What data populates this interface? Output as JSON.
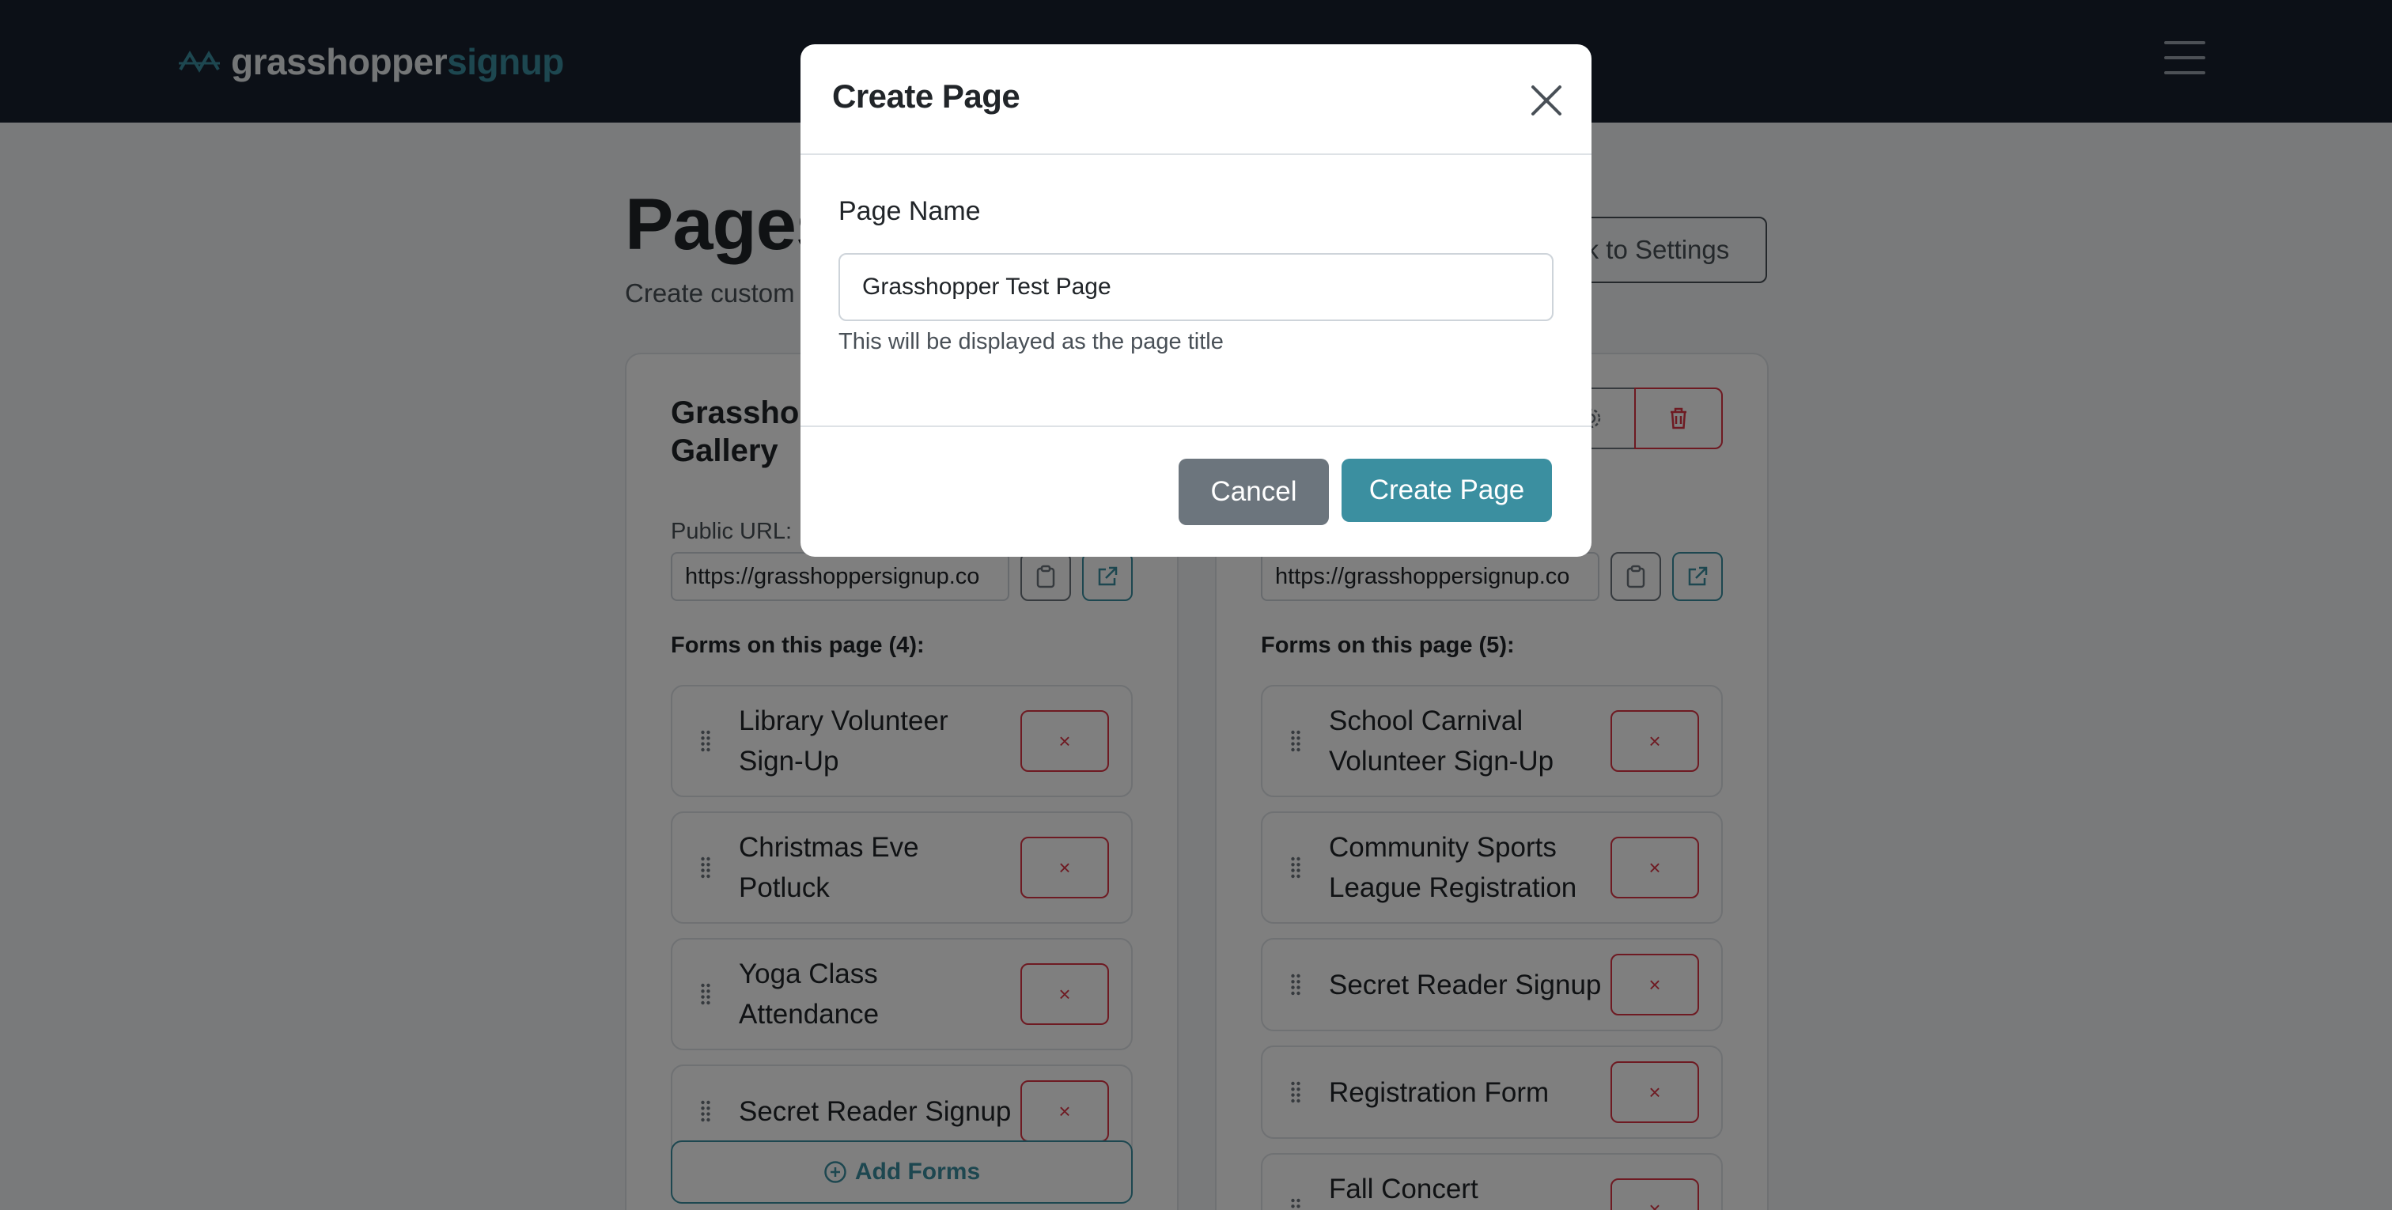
{
  "navbar": {
    "logo_part1": "grasshopper",
    "logo_part2": "signup"
  },
  "header": {
    "title": "Pages",
    "subtitle": "Create custom",
    "back_label": "Back to Settings"
  },
  "cards": [
    {
      "title_line1": "Grasshop",
      "title_line2": "Gallery",
      "url_label": "Public URL:",
      "url_value": "https://grasshoppersignup.co",
      "forms_label": "Forms on this page (4):",
      "forms": [
        {
          "name": "Library Volunteer Sign-Up"
        },
        {
          "name": "Christmas Eve Potluck"
        },
        {
          "name": "Yoga Class Attendance"
        },
        {
          "name": "Secret Reader Signup"
        }
      ],
      "add_label": "Add Forms"
    },
    {
      "url_value": "https://grasshoppersignup.co",
      "forms_label": "Forms on this page (5):",
      "forms": [
        {
          "name": "School Carnival Volunteer Sign-Up"
        },
        {
          "name": "Community Sports League Registration"
        },
        {
          "name": "Secret Reader Signup"
        },
        {
          "name": "Registration Form"
        },
        {
          "name": "Fall Concert Volunteer Signup"
        }
      ]
    }
  ],
  "remove_label": "×",
  "modal": {
    "title": "Create Page",
    "field_label": "Page Name",
    "field_value": "Grasshopper Test Page",
    "field_help": "This will be displayed as the page title",
    "cancel_label": "Cancel",
    "create_label": "Create Page"
  },
  "colors": {
    "navbar": "#19212e",
    "accent": "#3b8fa0",
    "danger": "#dc3545",
    "secondary": "#6c757d"
  },
  "icons": [
    "logo-icon",
    "hamburger-icon",
    "settings-icon",
    "trash-icon",
    "clipboard-icon",
    "external-link-icon",
    "drag-handle-icon",
    "plus-circle-icon",
    "close-icon"
  ]
}
